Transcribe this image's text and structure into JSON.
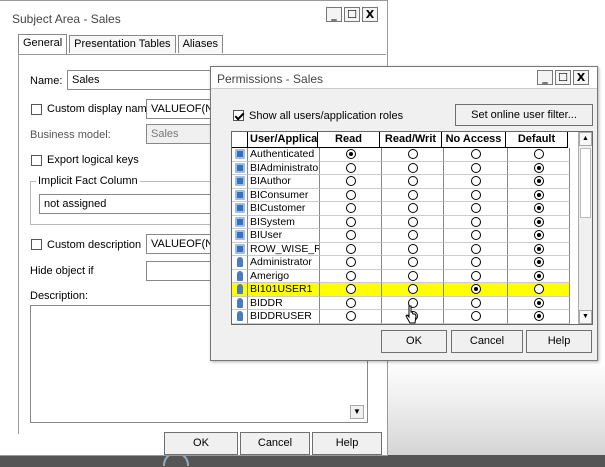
{
  "main_dialog": {
    "title": "Subject Area - Sales",
    "window_buttons": [
      "_",
      "☐",
      "X"
    ],
    "tabs": [
      {
        "label": "General",
        "active": true
      },
      {
        "label": "Presentation Tables",
        "active": false
      },
      {
        "label": "Aliases",
        "active": false
      }
    ],
    "name_label": "Name:",
    "name_value": "Sales",
    "custom_display_name_label": "Custom display name",
    "custom_display_name_value": "VALUEOF(N",
    "business_model_label": "Business model:",
    "business_model_value": "Sales",
    "export_logical_keys_label": "Export logical keys",
    "implicit_fact_label": "Implicit Fact Column",
    "implicit_fact_value": "not assigned",
    "custom_description_label": "Custom description",
    "custom_description_value": "VALUEOF(N",
    "hide_object_label": "Hide object if",
    "description_label": "Description:",
    "ok_label": "OK",
    "cancel_label": "Cancel",
    "help_label": "Help"
  },
  "permissions_dialog": {
    "title": "Permissions - Sales",
    "window_buttons": [
      "_",
      "☐",
      "X"
    ],
    "show_all_label": "Show all users/application roles",
    "show_all_checked": true,
    "set_filter_label": "Set online user filter...",
    "columns": [
      "User/Applica",
      "Read",
      "Read/Writ",
      "No Access",
      "Default"
    ],
    "rows": [
      {
        "name": "Authenticated",
        "kind": "role",
        "selected": 0,
        "highlight": false
      },
      {
        "name": "BIAdministrator",
        "kind": "role",
        "selected": 3,
        "highlight": false
      },
      {
        "name": "BIAuthor",
        "kind": "role",
        "selected": 3,
        "highlight": false
      },
      {
        "name": "BIConsumer",
        "kind": "role",
        "selected": 3,
        "highlight": false
      },
      {
        "name": "BICustomer",
        "kind": "role",
        "selected": 3,
        "highlight": false
      },
      {
        "name": "BISystem",
        "kind": "role",
        "selected": 3,
        "highlight": false
      },
      {
        "name": "BIUser",
        "kind": "role",
        "selected": 3,
        "highlight": false
      },
      {
        "name": "ROW_WISE_R",
        "kind": "role",
        "selected": 3,
        "highlight": false
      },
      {
        "name": "Administrator",
        "kind": "user",
        "selected": 3,
        "highlight": false
      },
      {
        "name": "Amerigo",
        "kind": "user",
        "selected": 3,
        "highlight": false
      },
      {
        "name": "BI101USER1",
        "kind": "user",
        "selected": 2,
        "highlight": true
      },
      {
        "name": "BIDDR",
        "kind": "user",
        "selected": 3,
        "highlight": false
      },
      {
        "name": "BIDDRUSER",
        "kind": "user",
        "selected": 3,
        "highlight": false
      }
    ],
    "ok_label": "OK",
    "cancel_label": "Cancel",
    "help_label": "Help"
  },
  "colors": {
    "highlight": "#ffff00",
    "role_icon": "#3d6fb6",
    "user_icon": "#4a7cc4"
  }
}
